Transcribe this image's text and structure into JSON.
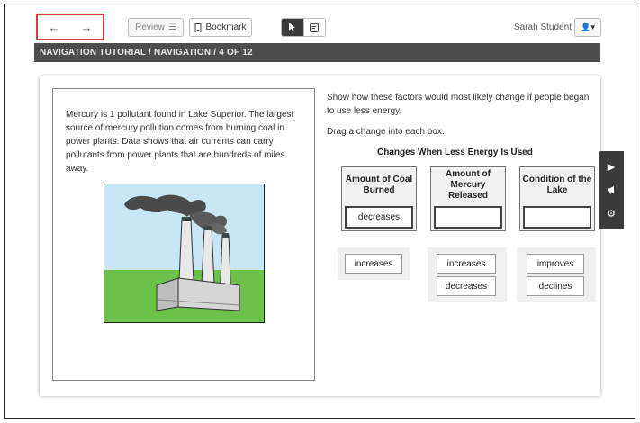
{
  "toolbar": {
    "back_icon": "←",
    "forward_icon": "→",
    "review_label": "Review",
    "review_icon": "☰",
    "bookmark_label": "Bookmark",
    "bookmark_icon": "🔖",
    "pointer_icon": "➤",
    "note_icon": "✎",
    "student_name": "Sarah Student",
    "user_icon": "👤▾"
  },
  "header": {
    "breadcrumb": "NAVIGATION TUTORIAL / NAVIGATION / 4 OF 12"
  },
  "passage": {
    "text": "Mercury is 1 pollutant found in Lake Superior. The largest source of mercury pollution comes from burning coal in power plants. Data shows that air currents can carry pollutants from power plants that are hundreds of miles away."
  },
  "question": {
    "prompt": "Show how these factors would most likely change if people began to use less energy.",
    "instruction": "Drag a change into each box.",
    "table_title": "Changes When Less Energy Is Used",
    "columns": [
      {
        "heading": "Amount of Coal Burned",
        "answer": "decreases"
      },
      {
        "heading": "Amount of Mercury Released",
        "answer": ""
      },
      {
        "heading": "Condition of the Lake",
        "answer": ""
      }
    ],
    "choices": {
      "coal": [
        "increases"
      ],
      "mercury": [
        "increases",
        "decreases"
      ],
      "lake": [
        "improves",
        "declines"
      ]
    }
  },
  "side_tools": {
    "play_icon": "▶",
    "megaphone_icon": "📢",
    "settings_icon": "⚙"
  },
  "colors": {
    "header_bar": "#4d4d4d",
    "highlight": "#d93a3a",
    "sky": "#c8e6f4",
    "grass": "#6cc14a"
  }
}
